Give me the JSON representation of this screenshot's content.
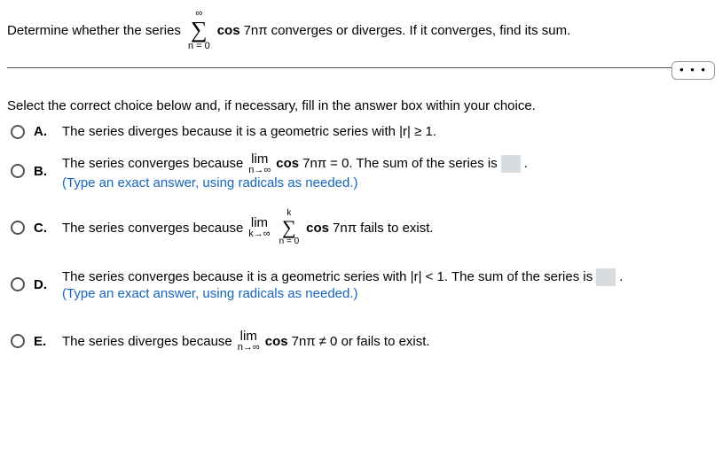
{
  "prompt": {
    "pre": "Determine whether the series",
    "sigma_top": "∞",
    "sigma_bot": "n = 0",
    "term": "cos",
    "arg": "7nπ",
    "post": "converges or diverges. If it converges, find its sum."
  },
  "ellipsis": "• • •",
  "instructions": "Select the correct choice below and, if necessary, fill in the answer box within your choice.",
  "choices": {
    "A": {
      "label": "A.",
      "text": "The series diverges because it is a geometric series with |r| ≥ 1."
    },
    "B": {
      "label": "B.",
      "pre": "The series converges because ",
      "lim": "lim",
      "lim_sub": "n→∞",
      "cos": "cos",
      "arg": "7nπ",
      "eq": "= 0. The sum of the series is",
      "period": ".",
      "hint": "(Type an exact answer, using radicals as needed.)"
    },
    "C": {
      "label": "C.",
      "pre": "The series converges because ",
      "lim": "lim",
      "lim_sub": "k→∞",
      "sigma_top": "k",
      "sigma_bot": "n = 0",
      "cos": "cos",
      "arg": "7nπ",
      "post": " fails to exist."
    },
    "D": {
      "label": "D.",
      "text": "The series converges because it is a geometric series with |r| < 1. The sum of the series is",
      "period": ".",
      "hint": "(Type an exact answer, using radicals as needed.)"
    },
    "E": {
      "label": "E.",
      "pre": "The series diverges because ",
      "lim": "lim",
      "lim_sub": "n→∞",
      "cos": "cos",
      "arg": "7nπ",
      "post": "≠ 0 or fails to exist."
    }
  }
}
